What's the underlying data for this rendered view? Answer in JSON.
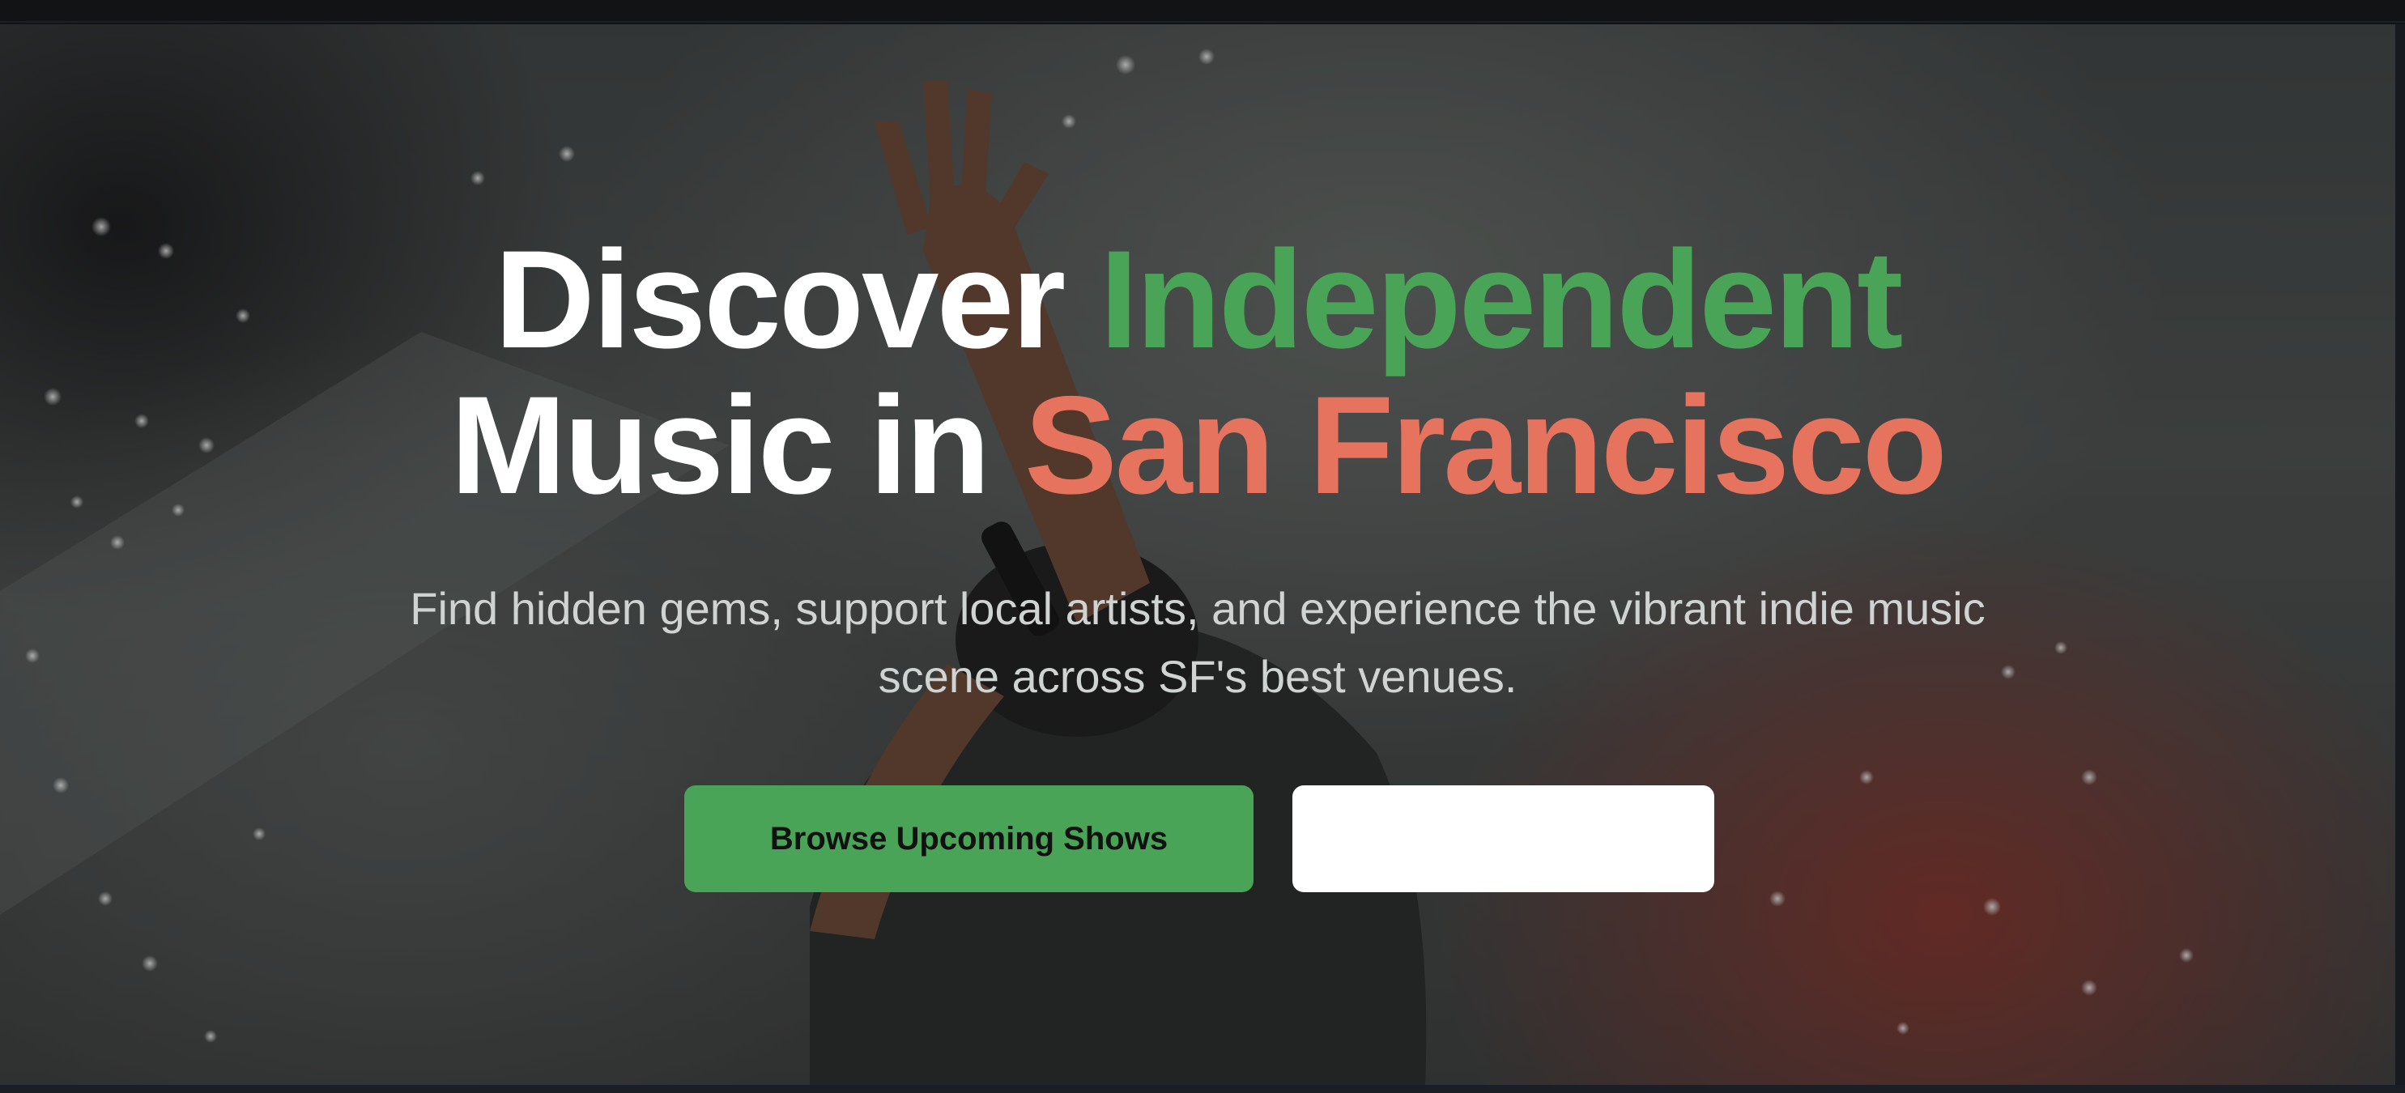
{
  "hero": {
    "headline_part1": "Discover ",
    "headline_highlight1": "Independent",
    "headline_part2": "Music in ",
    "headline_highlight2": "San Francisco",
    "subtitle": "Find hidden gems, support local artists, and experience the vibrant indie music scene across SF's best venues.",
    "primary_button_label": "Browse Upcoming Shows",
    "secondary_button_label": ""
  },
  "colors": {
    "accent_green": "#4aa457",
    "accent_coral": "#e5735e",
    "headline_white": "#ffffff",
    "subtitle_gray": "#cfd3d2",
    "background_dark": "#111214"
  },
  "background_image": "concert-performer-raised-hand-photo"
}
